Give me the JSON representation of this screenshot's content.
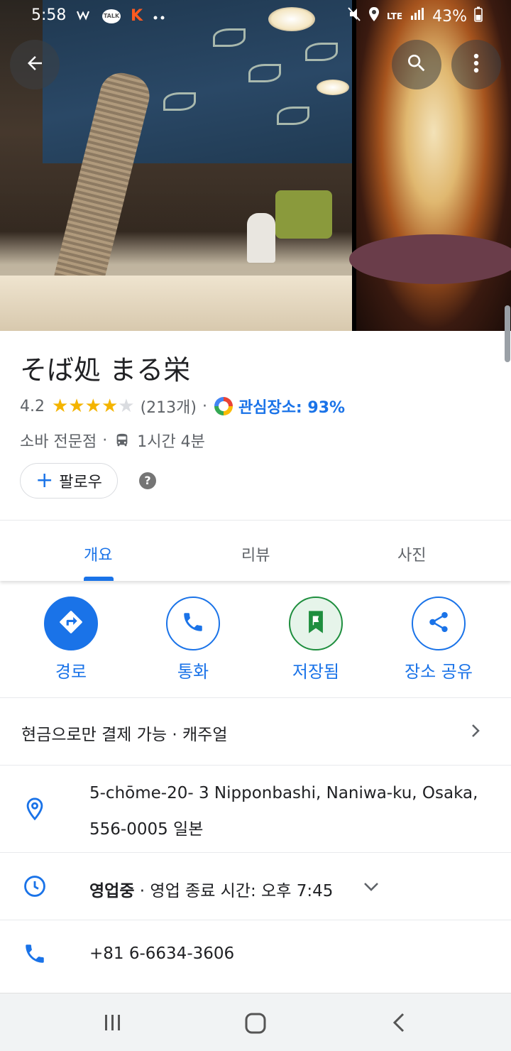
{
  "status_bar": {
    "time": "5:58",
    "network": "LTE",
    "battery": "43%",
    "icons": [
      "notification-icon",
      "kakaotalk-icon",
      "k-app-icon",
      "more-dots-icon",
      "mute-icon",
      "location-icon",
      "signal-icon",
      "battery-icon"
    ]
  },
  "place": {
    "name": "そば処 まる栄",
    "rating": "4.2",
    "rating_value": 4.2,
    "reviews": "(213개)",
    "separator": "·",
    "interest": "관심장소: 93%",
    "category": "소바 전문점",
    "transit_time": "1시간 4분"
  },
  "buttons": {
    "follow": "팔로우",
    "help": "?"
  },
  "tabs": [
    {
      "label": "개요",
      "active": true
    },
    {
      "label": "리뷰",
      "active": false
    },
    {
      "label": "사진",
      "active": false
    }
  ],
  "actions": [
    {
      "label": "경로",
      "icon": "directions-icon"
    },
    {
      "label": "통화",
      "icon": "phone-icon"
    },
    {
      "label": "저장됨",
      "icon": "bookmark-icon"
    },
    {
      "label": "장소 공유",
      "icon": "share-icon"
    }
  ],
  "info": {
    "attributes": "현금으로만 결제 가능 · 캐주얼",
    "address_line1": "5-chōme-20- 3  Nipponbashi, Naniwa-ku, Osaka,",
    "address_line2": "556-0005 일본",
    "hours_status": "영업중",
    "hours_detail": " · 영업 종료 시간: 오후 7:45",
    "phone": "+81 6-6634-3606"
  },
  "colors": {
    "accent": "#1a73e8",
    "star": "#f4b400",
    "saved_green": "#1e8e3e"
  }
}
